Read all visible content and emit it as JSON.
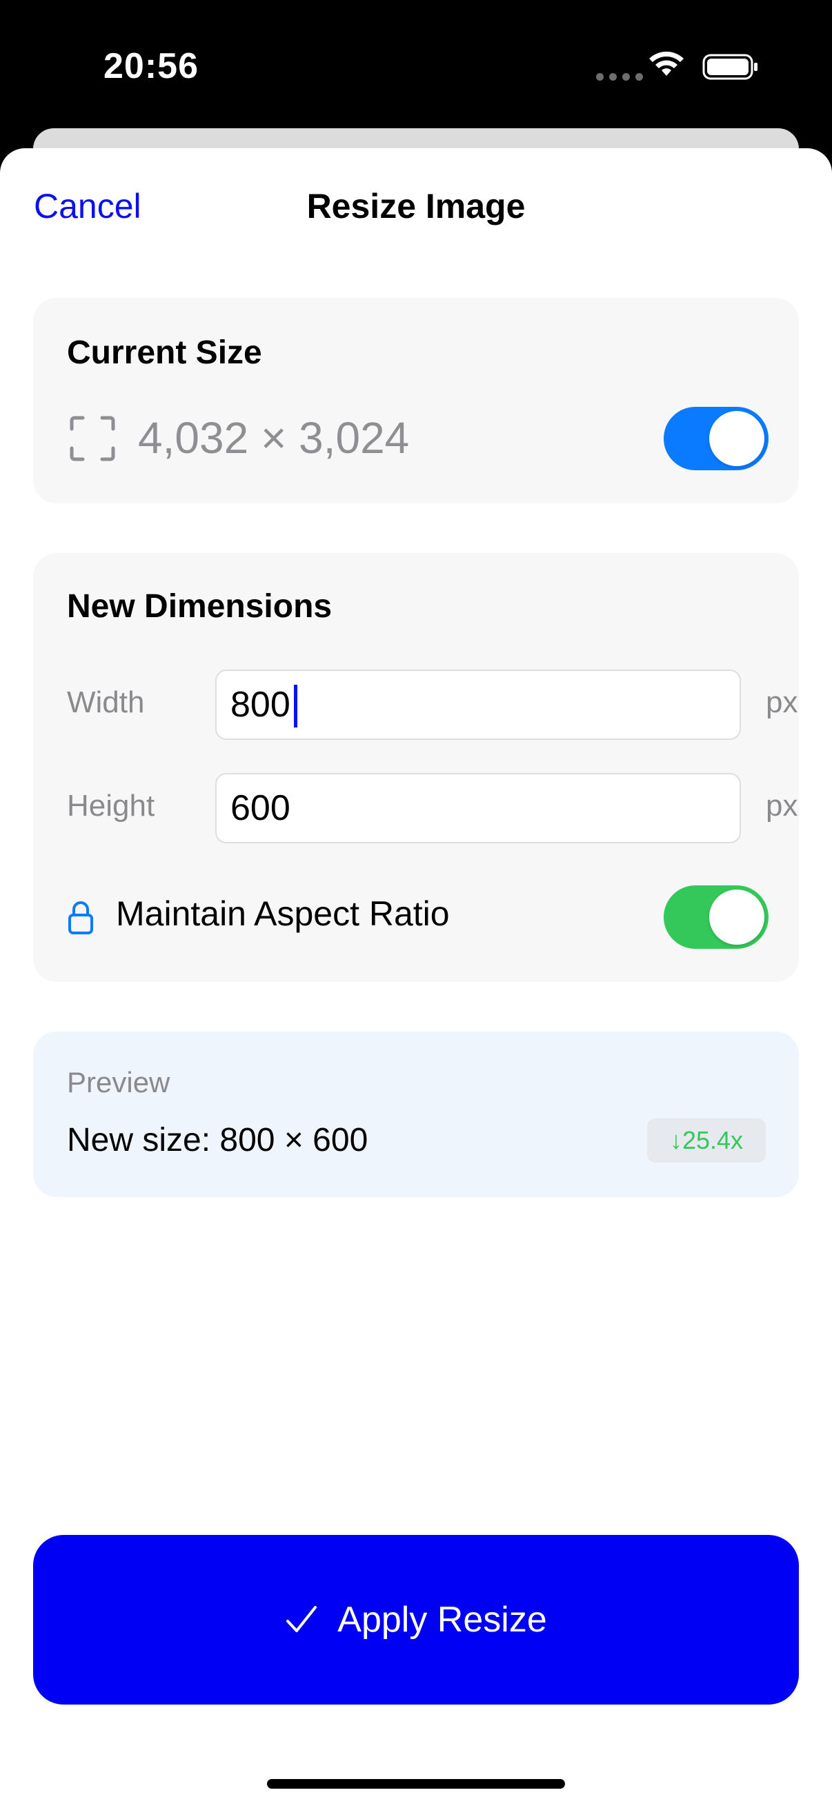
{
  "status_bar": {
    "time": "20:56"
  },
  "nav": {
    "cancel_label": "Cancel",
    "title": "Resize Image"
  },
  "current_size": {
    "title": "Current Size",
    "value": "4,032 × 3,024",
    "toggle_on": true,
    "icon": "resize-frame-icon"
  },
  "new_dimensions": {
    "title": "New Dimensions",
    "width_label": "Width",
    "width_value": "800",
    "height_label": "Height",
    "height_value": "600",
    "unit": "px",
    "aspect_label": "Maintain Aspect Ratio",
    "aspect_on": true
  },
  "preview": {
    "caption": "Preview",
    "size_text": "New size: 800 × 600",
    "ratio_badge": "↓25.4x"
  },
  "apply": {
    "label": "Apply Resize"
  },
  "colors": {
    "accent_blue": "#0a10f0",
    "toggle_blue": "#0a7aff",
    "toggle_green": "#34c759",
    "apply_button": "#0000f5"
  }
}
